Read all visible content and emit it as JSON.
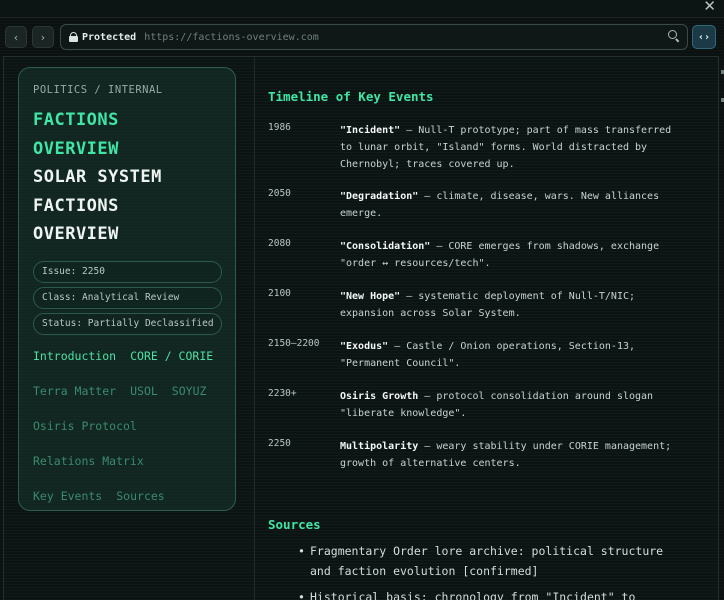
{
  "browser": {
    "close_glyph": "✕",
    "back_glyph": "‹",
    "forward_glyph": "›",
    "secure_label": "Protected",
    "url": "https://factions-overview.com",
    "code_glyph": "‹›"
  },
  "sidebar": {
    "breadcrumb": "POLITICS / INTERNAL",
    "title_green": [
      "FACTIONS",
      "OVERVIEW"
    ],
    "title_white": [
      "SOLAR SYSTEM",
      "FACTIONS",
      "OVERVIEW"
    ],
    "pills": [
      "Issue: 2250",
      "Class: Analytical Review",
      "Status: Partially Declassified"
    ],
    "nav_rows": [
      [
        {
          "label": "Introduction",
          "active": true
        },
        {
          "label": "CORE / CORIE",
          "active": true
        }
      ],
      [
        {
          "label": "Terra Matter",
          "active": false
        },
        {
          "label": "USOL",
          "active": false
        },
        {
          "label": "SOYUZ",
          "active": false
        }
      ],
      [
        {
          "label": "Osiris Protocol",
          "active": false
        }
      ],
      [
        {
          "label": "Relations Matrix",
          "active": false
        }
      ],
      [
        {
          "label": "Key Events",
          "active": false
        },
        {
          "label": "Sources",
          "active": false
        }
      ]
    ]
  },
  "timeline": {
    "heading": "Timeline of Key Events",
    "events": [
      {
        "year": "1986",
        "name": "\"Incident\"",
        "text": " – Null-T prototype; part of mass transferred to lunar orbit, \"Island\" forms. World distracted by Chernobyl; traces covered up."
      },
      {
        "year": "2050",
        "name": "\"Degradation\"",
        "text": " – climate, disease, wars. New alliances emerge."
      },
      {
        "year": "2080",
        "name": "\"Consolidation\"",
        "text": " – CORE emerges from shadows, exchange \"order ↔ resources/tech\"."
      },
      {
        "year": "2100",
        "name": "\"New Hope\"",
        "text": " – systematic deployment of Null-T/NIC; expansion across Solar System."
      },
      {
        "year": "2150–2200",
        "name": "\"Exodus\"",
        "text": " – Castle / Onion operations, Section-13, \"Permanent Council\"."
      },
      {
        "year": "2230+",
        "name": "Osiris Growth",
        "text": " – protocol consolidation around slogan \"liberate knowledge\"."
      },
      {
        "year": "2250",
        "name": "Multipolarity",
        "text": " – weary stability under CORIE management; growth of alternative centers."
      }
    ]
  },
  "sources": {
    "heading": "Sources",
    "items": [
      "Fragmentary Order lore archive: political structure and faction evolution [confirmed]",
      "Historical basis: chronology from \"Incident\" to"
    ]
  }
}
